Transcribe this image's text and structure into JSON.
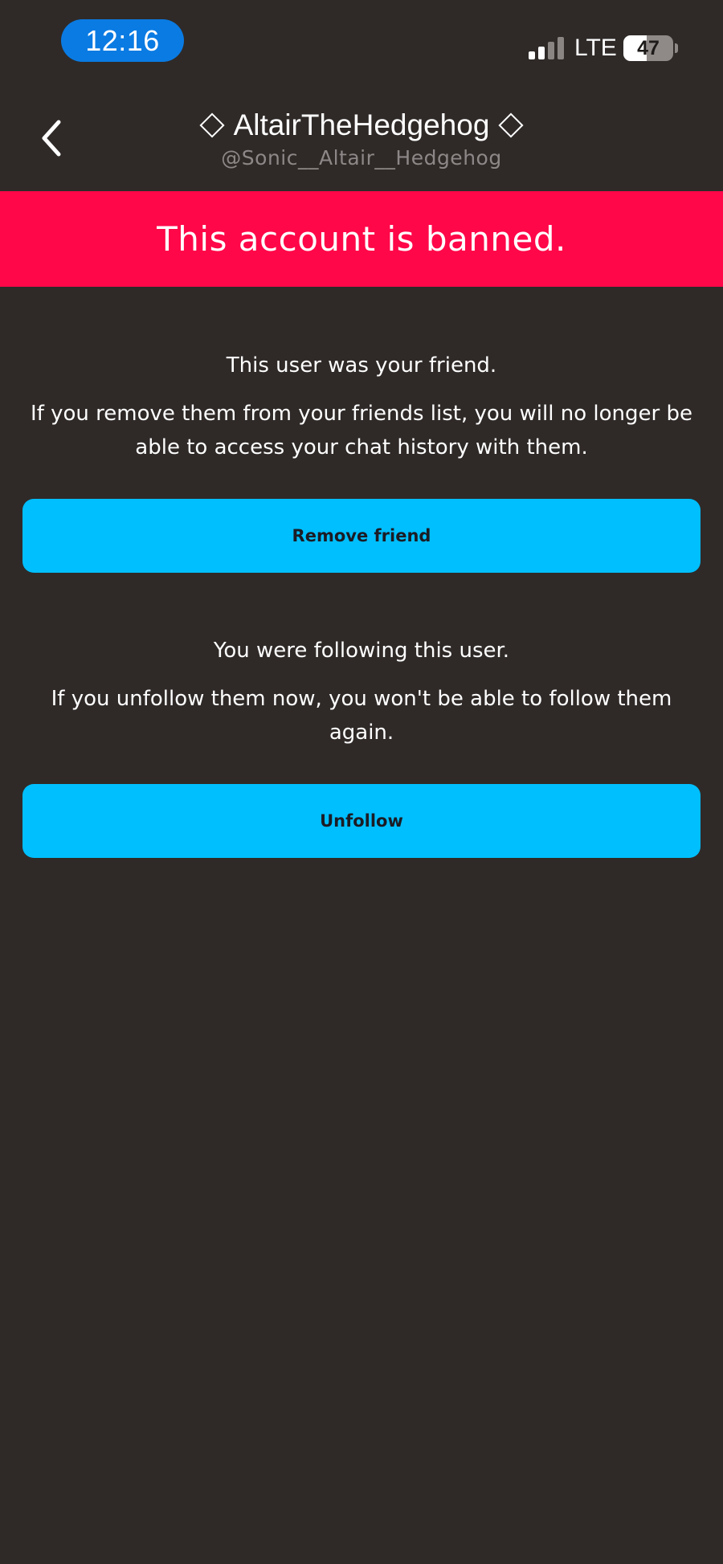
{
  "status_bar": {
    "time": "12:16",
    "network": "LTE",
    "battery_level": "47"
  },
  "header": {
    "back_icon": "chevron-left-icon",
    "display_name": "AltairTheHedgehog",
    "handle": "@Sonic__Altair__Hedgehog"
  },
  "banner": {
    "text": "This account is banned.",
    "color": "#ff0749"
  },
  "friend_section": {
    "heading": "This user was your friend.",
    "body": "If you remove them from your friends list, you will no longer be able to access your chat history with them.",
    "button_label": "Remove friend"
  },
  "follow_section": {
    "heading": "You were following this user.",
    "body": "If you unfollow them now, you won't be able to follow them again.",
    "button_label": "Unfollow"
  },
  "colors": {
    "background": "#2f2a28",
    "accent_button": "#00bfff",
    "time_pill": "#0a7be3"
  }
}
